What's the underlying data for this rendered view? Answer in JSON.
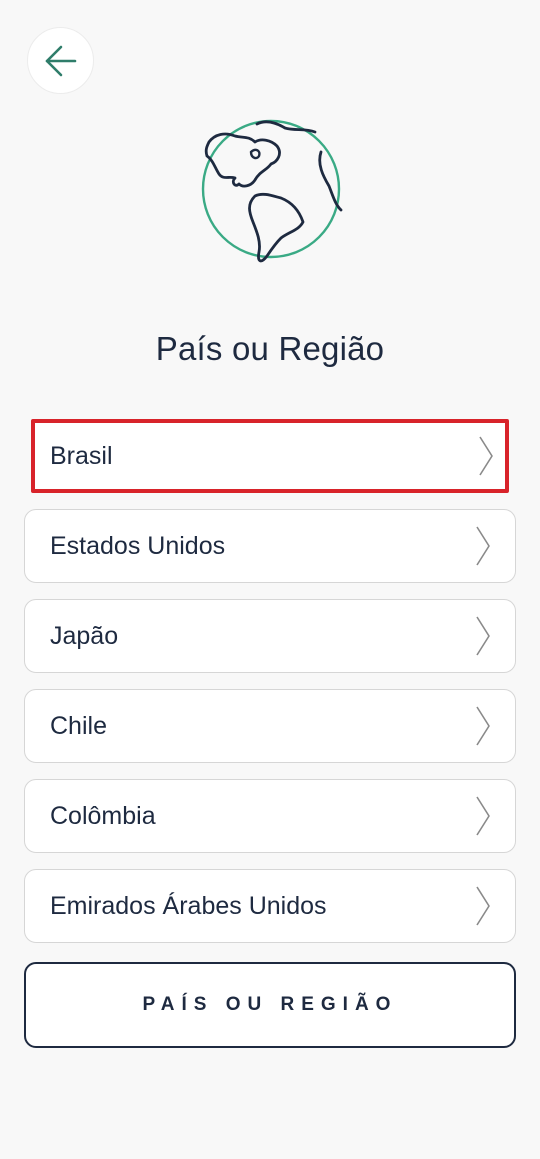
{
  "header": {
    "back_icon": "arrow-left-icon",
    "illustration_icon": "globe-americas-icon"
  },
  "title": "País ou Região",
  "countries": [
    {
      "label": "Brasil",
      "selected": true
    },
    {
      "label": "Estados Unidos",
      "selected": false
    },
    {
      "label": "Japão",
      "selected": false
    },
    {
      "label": "Chile",
      "selected": false
    },
    {
      "label": "Colômbia",
      "selected": false
    },
    {
      "label": "Emirados Árabes Unidos",
      "selected": false
    }
  ],
  "primary_button": {
    "label": "PAÍS OU REGIÃO"
  },
  "colors": {
    "text": "#1e2a40",
    "accent_green": "#3aaa85",
    "selection_outline": "#d8232a",
    "background": "#f8f8f8"
  }
}
